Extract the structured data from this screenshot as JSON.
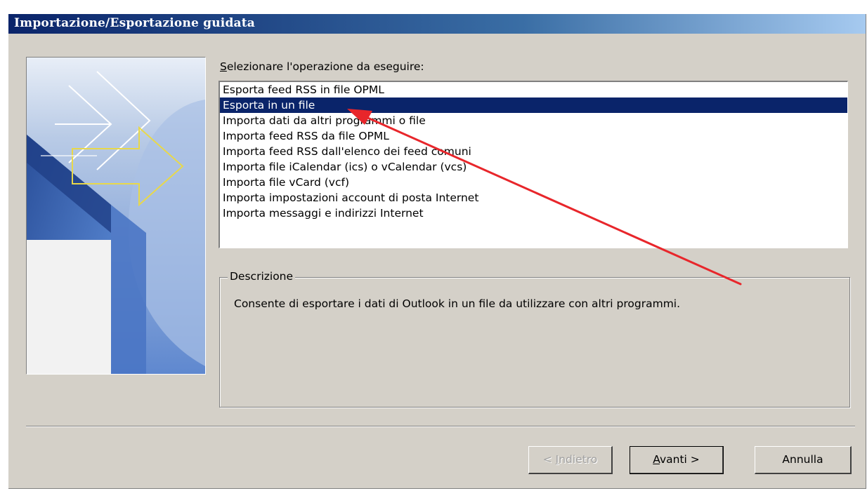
{
  "window": {
    "title": "Importazione/Esportazione guidata"
  },
  "prompt": {
    "label_mnemonic": "S",
    "label_rest": "elezionare l'operazione da eseguire:"
  },
  "list": {
    "items": [
      "Esporta feed RSS in file OPML",
      "Esporta in un file",
      "Importa dati da altri programmi o file",
      "Importa feed RSS da file OPML",
      "Importa feed RSS dall'elenco dei feed comuni",
      "Importa file iCalendar (ics) o vCalendar (vcs)",
      "Importa file vCard (vcf)",
      "Importa impostazioni account di posta Internet",
      "Importa messaggi e indirizzi Internet"
    ],
    "selected": "Esporta in un file"
  },
  "description": {
    "legend": "Descrizione",
    "text": "Consente di esportare i dati di Outlook in un file da utilizzare con altri programmi."
  },
  "buttons": {
    "back_prefix": "< ",
    "back_mnemonic": "I",
    "back_rest": "ndietro",
    "next_mnemonic": "A",
    "next_rest": "vanti >",
    "cancel": "Annulla"
  },
  "colors": {
    "selection": "#0a246a",
    "annotation_arrow": "#e8262b",
    "dialog_face": "#d4d0c8"
  },
  "icons": {
    "wizard_image": "wizard-arrows-illustration",
    "annotation": "red-arrow-annotation"
  }
}
